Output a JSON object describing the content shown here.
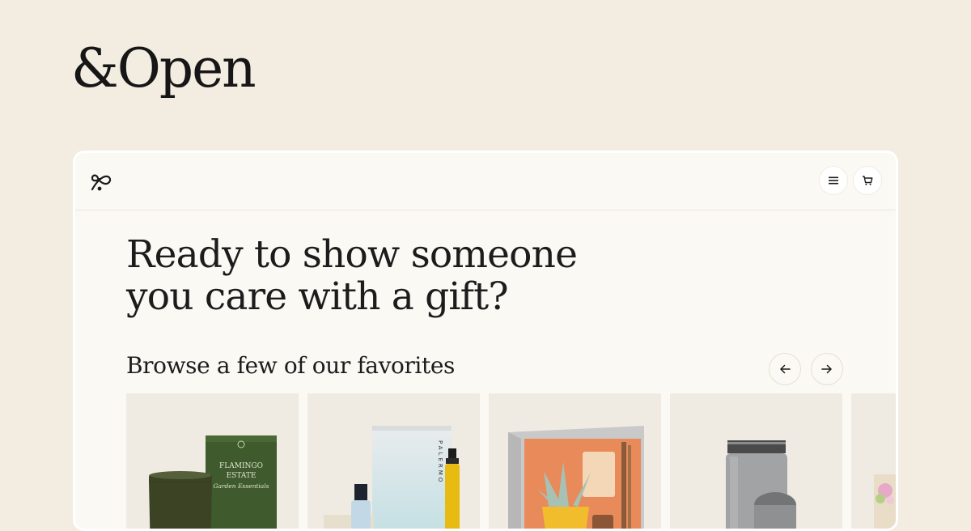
{
  "brand": {
    "name": "&Open"
  },
  "header": {
    "logo_icon": "loop-logo-icon",
    "menu_icon": "hamburger-menu-icon",
    "cart_icon": "shopping-cart-icon"
  },
  "hero": {
    "headline_line1": "Ready to show someone",
    "headline_line2": "you care with a gift?"
  },
  "favorites": {
    "heading": "Browse a few of our favorites",
    "prev_icon": "arrow-left-icon",
    "next_icon": "arrow-right-icon",
    "products": [
      {
        "image": "candle-gift-box",
        "box_text": [
          "FLAMINGO",
          "ESTATE",
          "Garden Essentials"
        ]
      },
      {
        "image": "skincare-serum-set",
        "box_text": [
          "PALERMO"
        ]
      },
      {
        "image": "plant-gift-box"
      },
      {
        "image": "gray-tumbler"
      },
      {
        "image": "flower-product-partial"
      }
    ]
  },
  "colors": {
    "page_background": "#f2ece1",
    "panel_background": "#fbf9f4",
    "text": "#1c1c1c"
  }
}
